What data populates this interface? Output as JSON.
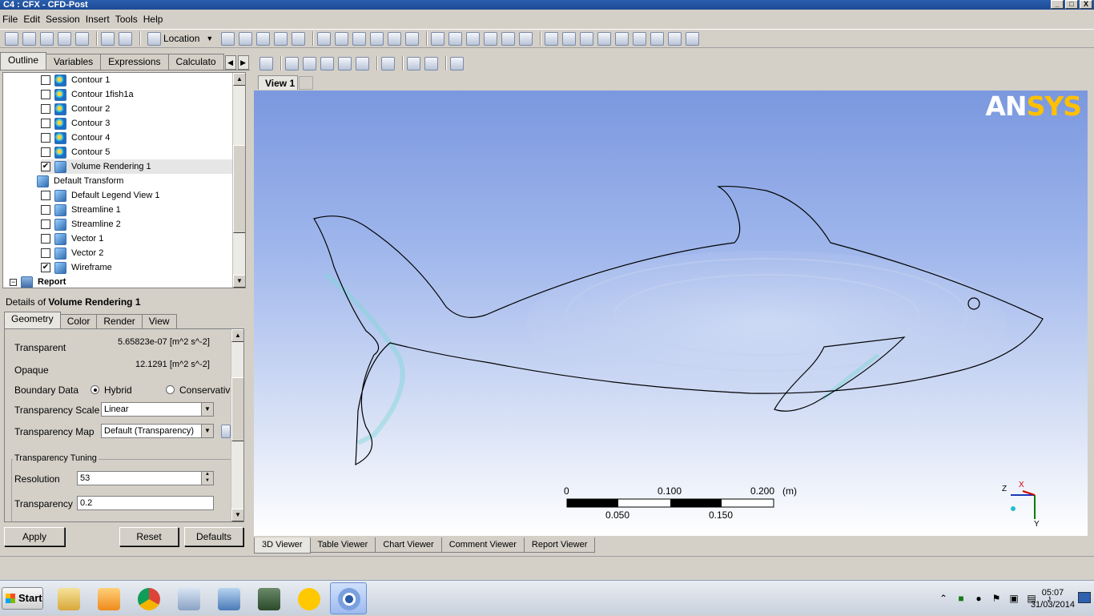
{
  "window": {
    "title": "C4 : CFX - CFD-Post",
    "controls": [
      "_",
      "□",
      "X"
    ]
  },
  "menu": [
    "File",
    "Edit",
    "Session",
    "Insert",
    "Tools",
    "Help"
  ],
  "toolbar": {
    "location_label": "Location"
  },
  "left_tabs": [
    "Outline",
    "Variables",
    "Expressions",
    "Calculato"
  ],
  "tree": {
    "items": [
      {
        "label": "Contour 1",
        "checked": false,
        "icon": "contour-icon"
      },
      {
        "label": "Contour 1fish1a",
        "checked": false,
        "icon": "contour-icon"
      },
      {
        "label": "Contour 2",
        "checked": false,
        "icon": "contour-icon"
      },
      {
        "label": "Contour 3",
        "checked": false,
        "icon": "contour-icon"
      },
      {
        "label": "Contour 4",
        "checked": false,
        "icon": "contour-icon"
      },
      {
        "label": "Contour 5",
        "checked": false,
        "icon": "contour-icon"
      },
      {
        "label": "Volume Rendering 1",
        "checked": true,
        "icon": "volume-rendering-icon",
        "selected": true
      },
      {
        "label": "Default Transform",
        "icon": "transform-icon",
        "nocheck": true
      },
      {
        "label": "Default Legend View 1",
        "checked": false,
        "icon": "legend-icon"
      },
      {
        "label": "Streamline 1",
        "checked": false,
        "icon": "streamline-icon"
      },
      {
        "label": "Streamline 2",
        "checked": false,
        "icon": "streamline-icon"
      },
      {
        "label": "Vector 1",
        "checked": false,
        "icon": "vector-icon"
      },
      {
        "label": "Vector 2",
        "checked": false,
        "icon": "vector-icon"
      },
      {
        "label": "Wireframe",
        "checked": true,
        "icon": "wireframe-icon"
      }
    ],
    "report_label": "Report"
  },
  "details": {
    "prefix": "Details of ",
    "object": "Volume Rendering 1",
    "tabs": [
      "Geometry",
      "Color",
      "Render",
      "View"
    ],
    "transparent_label": "Transparent",
    "transparent_value": "5.65823e-07 [m^2 s^-2]",
    "opaque_label": "Opaque",
    "opaque_value": "12.1291 [m^2 s^-2]",
    "boundary_label": "Boundary Data",
    "boundary_opt1": "Hybrid",
    "boundary_opt2": "Conservative",
    "tscale_label": "Transparency Scale",
    "tscale_value": "Linear",
    "tmap_label": "Transparency Map",
    "tmap_value": "Default (Transparency)",
    "tuning_title": "Transparency Tuning",
    "resolution_label": "Resolution",
    "resolution_value": "53",
    "transparency_label": "Transparency",
    "transparency_value": "0.2"
  },
  "buttons": {
    "apply": "Apply",
    "reset": "Reset",
    "defaults": "Defaults"
  },
  "view": {
    "tab": "View 1",
    "logo_a": "AN",
    "logo_b": "SYS"
  },
  "scale_bar": {
    "t0": "0",
    "t1": "0.100",
    "t2": "0.200",
    "unit": "(m)",
    "b1": "0.050",
    "b2": "0.150"
  },
  "axes": {
    "z": "Z",
    "x": "X",
    "y": "Y"
  },
  "bottom_tabs": [
    "3D Viewer",
    "Table Viewer",
    "Chart Viewer",
    "Comment Viewer",
    "Report Viewer"
  ],
  "taskbar": {
    "start": "Start",
    "time": "05:07",
    "date": "31/03/2014"
  }
}
